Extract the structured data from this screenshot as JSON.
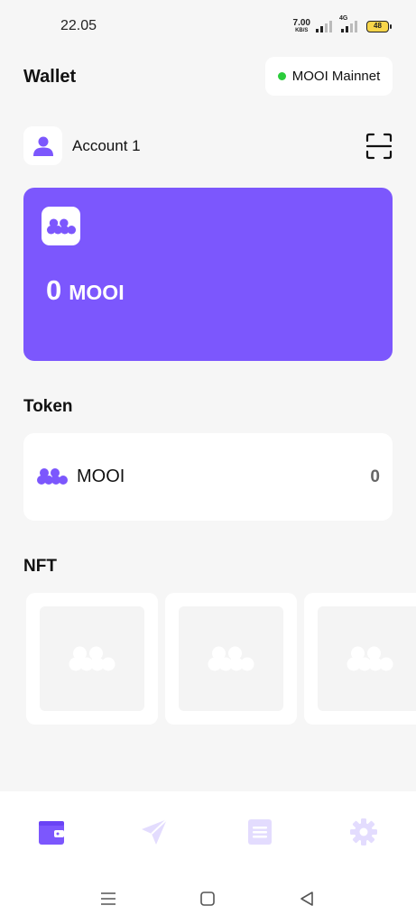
{
  "status_bar": {
    "time": "22.05",
    "net_speed_value": "7.00",
    "net_speed_unit": "KB/S",
    "network_type": "4G",
    "battery_level": "48"
  },
  "header": {
    "title": "Wallet",
    "network_name": "MOOI Mainnet",
    "network_status_color": "#2bcc3b"
  },
  "account": {
    "name": "Account 1",
    "avatar_icon": "user-icon",
    "scan_icon": "scan-qr-icon"
  },
  "balance_card": {
    "amount": "0",
    "unit": "MOOI",
    "background_color": "#7c57fd",
    "logo_icon": "mooi-logo-icon"
  },
  "token_section": {
    "title": "Token",
    "items": [
      {
        "name": "MOOI",
        "balance": "0",
        "icon": "mooi-logo-icon"
      }
    ]
  },
  "nft_section": {
    "title": "NFT",
    "placeholder_count": 3
  },
  "bottom_nav": {
    "active_color": "#7c57fd",
    "inactive_color": "#e3dcfe",
    "items": [
      {
        "icon": "wallet-icon",
        "active": true
      },
      {
        "icon": "send-icon",
        "active": false
      },
      {
        "icon": "history-icon",
        "active": false
      },
      {
        "icon": "settings-gear-icon",
        "active": false
      }
    ]
  },
  "system_nav": {
    "items": [
      "menu-icon",
      "home-icon",
      "back-icon"
    ]
  }
}
